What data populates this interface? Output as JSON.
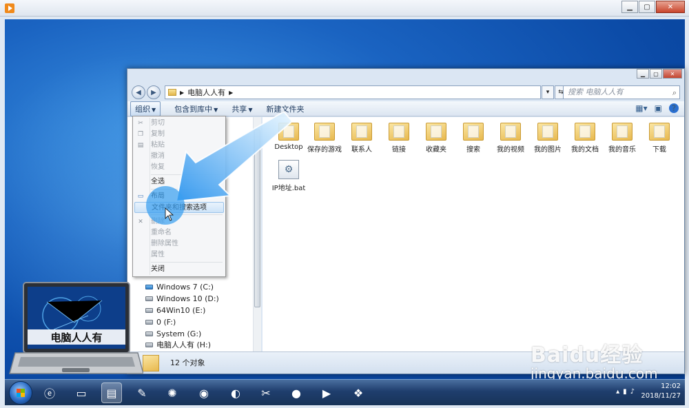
{
  "explorer": {
    "address_path": "电脑人人有",
    "search_placeholder": "搜索 电脑人人有",
    "toolbar": {
      "organize": "组织",
      "include_library": "包含到库中",
      "share": "共享",
      "new_folder": "新建文件夹"
    },
    "files": [
      {
        "name": "Desktop",
        "icon": "folder-icon"
      },
      {
        "name": "保存的游戏",
        "icon": "folder-icon"
      },
      {
        "name": "联系人",
        "icon": "folder-icon"
      },
      {
        "name": "链接",
        "icon": "folder-icon"
      },
      {
        "name": "收藏夹",
        "icon": "folder-icon"
      },
      {
        "name": "搜索",
        "icon": "folder-icon"
      },
      {
        "name": "我的视频",
        "icon": "folder-icon"
      },
      {
        "name": "我的图片",
        "icon": "folder-icon"
      },
      {
        "name": "我的文档",
        "icon": "folder-icon"
      },
      {
        "name": "我的音乐",
        "icon": "folder-icon"
      },
      {
        "name": "下载",
        "icon": "folder-icon"
      },
      {
        "name": "IP地址.bat",
        "icon": "batch-file-icon"
      }
    ],
    "drives": [
      {
        "label": "Windows 7 (C:)"
      },
      {
        "label": "Windows 10 (D:)"
      },
      {
        "label": "64Win10 (E:)"
      },
      {
        "label": "0 (F:)"
      },
      {
        "label": "System (G:)"
      },
      {
        "label": "电脑人人有 (H:)"
      }
    ],
    "status": "12 个对象"
  },
  "context_menu": {
    "items": [
      {
        "label": "剪切",
        "disabled": true
      },
      {
        "label": "复制",
        "disabled": true
      },
      {
        "label": "粘贴",
        "disabled": true
      },
      {
        "label": "撤消",
        "disabled": true
      },
      {
        "label": "恢复",
        "disabled": true
      },
      {
        "label": "全选",
        "disabled": false
      },
      {
        "label": "布局",
        "disabled": false
      },
      {
        "label": "文件夹和搜索选项",
        "disabled": false,
        "highlighted": true
      },
      {
        "label": "删除",
        "disabled": true
      },
      {
        "label": "重命名",
        "disabled": true
      },
      {
        "label": "删除属性",
        "disabled": true
      },
      {
        "label": "属性",
        "disabled": true
      },
      {
        "label": "关闭",
        "disabled": false
      }
    ]
  },
  "laptop_logo": {
    "text": "电脑人人有"
  },
  "taskbar": {
    "time": "12:02",
    "date": "2018/11/27"
  },
  "watermark": {
    "logo": "Baidu经验",
    "url": "jingyan.baidu.com"
  },
  "colors": {
    "accent_arrow": "#3aa0f0",
    "desktop_blue": "#1a63c1",
    "menu_highlight": "#cde3f8"
  }
}
